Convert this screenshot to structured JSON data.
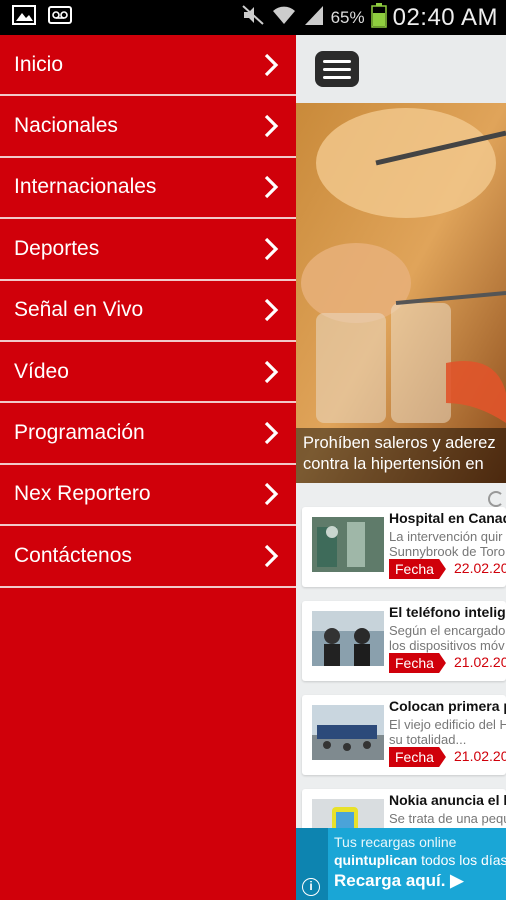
{
  "status_bar": {
    "icons": [
      "image-icon",
      "voicemail-icon",
      "mute-icon",
      "wifi-icon",
      "signal-icon",
      "battery-icon"
    ],
    "battery_percent": "65%",
    "time": "02:40 AM"
  },
  "drawer": {
    "items": [
      {
        "label": "Inicio"
      },
      {
        "label": "Nacionales"
      },
      {
        "label": "Internacionales"
      },
      {
        "label": "Deportes"
      },
      {
        "label": "Señal en Vivo"
      },
      {
        "label": "Vídeo"
      },
      {
        "label": "Programación"
      },
      {
        "label": "Nex Reportero"
      },
      {
        "label": "Contáctenos"
      }
    ]
  },
  "hero": {
    "caption_line1": "Prohíben saleros y aderez",
    "caption_line2": "contra la hipertensión en"
  },
  "news": {
    "date_label": "Fecha",
    "items": [
      {
        "title": "Hospital en Canad",
        "summary_line1": "La intervención quir",
        "summary_line2": "Sunnybrook de Toro",
        "date": "22.02.20"
      },
      {
        "title": "El teléfono intelige",
        "summary_line1": "Según el encargado",
        "summary_line2": "los dispositivos móv",
        "date": "21.02.20"
      },
      {
        "title": "Colocan primera p",
        "summary_line1": "El viejo edificio del H",
        "summary_line2": "su totalidad...",
        "date": "21.02.20"
      },
      {
        "title": "Nokia anuncia el l",
        "summary_line1": "Se trata de una pequ",
        "summary_line2": "",
        "date": ""
      }
    ]
  },
  "ad": {
    "line1": "Tus recargas online",
    "line2_bold": "quintuplican",
    "line2_rest": " todos los días",
    "cta": "Recarga aquí.",
    "info": "i"
  },
  "colors": {
    "brand_red": "#d0000a",
    "ad_blue": "#1aa6d6"
  }
}
